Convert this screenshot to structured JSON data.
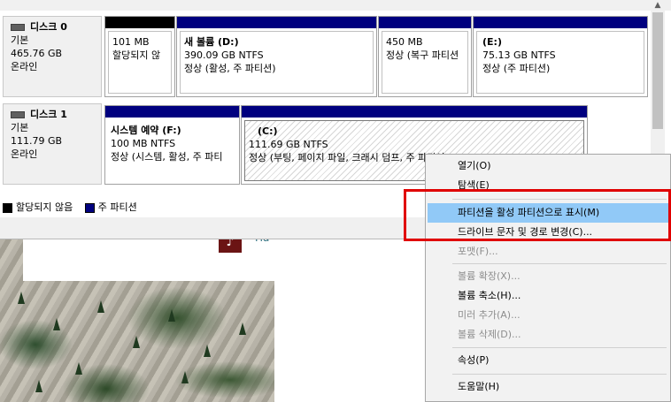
{
  "disks": [
    {
      "name": "디스크 0",
      "type": "기본",
      "size": "465.76 GB",
      "status": "온라인",
      "partitions": [
        {
          "title": "",
          "size": "101 MB",
          "detail": "할당되지 않"
        },
        {
          "title": "새 볼륨  (D:)",
          "size": "390.09 GB NTFS",
          "detail": "정상 (활성, 주 파티션)"
        },
        {
          "title": "",
          "size": "450 MB",
          "detail": "정상 (복구 파티션"
        },
        {
          "title": "(E:)",
          "size": "75.13 GB NTFS",
          "detail": "정상 (주 파티션)"
        }
      ]
    },
    {
      "name": "디스크 1",
      "type": "기본",
      "size": "111.79 GB",
      "status": "온라인",
      "partitions": [
        {
          "title": "시스템 예약  (F:)",
          "size": "100 MB NTFS",
          "detail": "정상 (시스템, 활성, 주 파티"
        },
        {
          "title": "(C:)",
          "size": "111.69 GB NTFS",
          "detail": "정상 (부팅, 페이지 파일, 크래시 덤프, 주 파티션)"
        }
      ]
    }
  ],
  "legend": [
    {
      "label": "할당되지 않음",
      "color": "#000000"
    },
    {
      "label": "주 파티션",
      "color": "#00007f"
    }
  ],
  "background_app": {
    "icon_glyph": "♪",
    "label": "Ha"
  },
  "context_menu": {
    "items": [
      {
        "label": "열기(O)",
        "enabled": true
      },
      {
        "label": "탐색(E)",
        "enabled": true
      },
      {
        "label": "파티션을 활성 파티션으로 표시(M)",
        "enabled": true,
        "highlighted": true
      },
      {
        "label": "드라이브 문자 및 경로 변경(C)...",
        "enabled": true
      },
      {
        "label": "포맷(F)...",
        "enabled": false
      },
      {
        "label": "볼륨 확장(X)...",
        "enabled": false
      },
      {
        "label": "볼륨 축소(H)...",
        "enabled": true
      },
      {
        "label": "미러 추가(A)...",
        "enabled": false
      },
      {
        "label": "볼륨 삭제(D)...",
        "enabled": false
      },
      {
        "label": "속성(P)",
        "enabled": true
      },
      {
        "label": "도움말(H)",
        "enabled": true
      }
    ]
  },
  "colors": {
    "primary_partition": "#00007f",
    "unallocated": "#000000",
    "highlight": "#91c9f7",
    "annotation": "#e00000"
  }
}
